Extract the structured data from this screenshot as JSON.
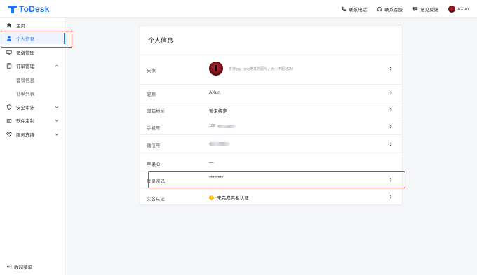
{
  "app": {
    "name": "ToDesk",
    "brand_color": "#1e74ff"
  },
  "header": {
    "actions": [
      {
        "label": "联系电话",
        "icon": "phone-icon"
      },
      {
        "label": "联系客服",
        "icon": "headset-icon"
      },
      {
        "label": "意见反馈",
        "icon": "feedback-icon"
      }
    ],
    "user": {
      "name": "AXun",
      "icon": "avatar"
    }
  },
  "sidebar": {
    "items": [
      {
        "label": "主页",
        "icon": "home-icon"
      },
      {
        "label": "个人信息",
        "icon": "user-icon",
        "active": true
      },
      {
        "label": "设备管理",
        "icon": "device-icon"
      },
      {
        "label": "订单管理",
        "icon": "order-icon",
        "expanded": true
      },
      {
        "label": "套餐信息",
        "sub": true
      },
      {
        "label": "订单列表",
        "sub": true
      },
      {
        "label": "安全审计",
        "icon": "shield-icon"
      },
      {
        "label": "软件定制",
        "icon": "gift-icon"
      },
      {
        "label": "服务支持",
        "icon": "heart-icon"
      }
    ],
    "collapse_label": "收起菜单"
  },
  "profile": {
    "title": "个人信息",
    "avatar_label": "头像",
    "avatar_hint": "支持jpg、png格式的图片，大小不超过2M",
    "nickname_label": "昵称",
    "nickname_value": "AXun",
    "email_label": "邮箱地址",
    "email_value": "暂未绑定",
    "phone_label": "手机号",
    "phone_value": "188",
    "wechat_label": "微信号",
    "wechat_value": "",
    "apple_label": "苹果ID",
    "apple_value": "—",
    "password_label": "登录密码",
    "password_value": "********",
    "realname_label": "实名认证",
    "realname_value": "未完成实名认证",
    "warn_color": "#f6b500"
  },
  "highlight_color": "#e53935"
}
